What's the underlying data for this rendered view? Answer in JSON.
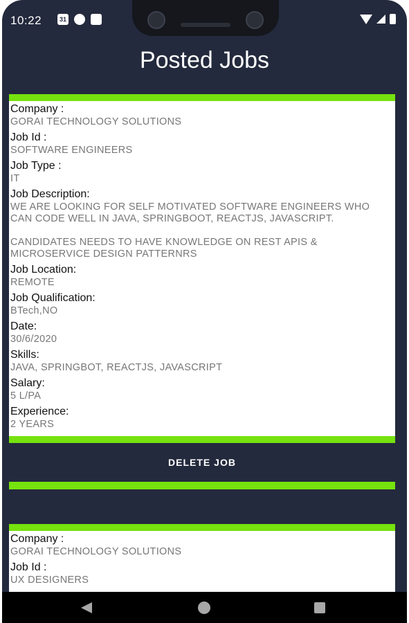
{
  "status_bar": {
    "time": "10:22",
    "left_icons": [
      {
        "icon": "calendar-icon",
        "text": "31"
      },
      {
        "icon": "app-notification-icon",
        "text": ""
      },
      {
        "icon": "sd-card-icon",
        "text": ""
      }
    ],
    "right_icons": [
      "wifi-icon",
      "cell-signal-icon",
      "battery-icon"
    ]
  },
  "header": {
    "title": "Posted Jobs"
  },
  "labels": {
    "company": "Company :",
    "job_id": "Job Id :",
    "job_type": "Job Type :",
    "job_description": "Job Description:",
    "job_location": "Job Location:",
    "job_qualification": "Job Qualification:",
    "date": "Date:",
    "skills": "Skills:",
    "salary": "Salary:",
    "experience": "Experience:"
  },
  "jobs": [
    {
      "company": "GORAI TECHNOLOGY SOLUTIONS",
      "job_id": "SOFTWARE ENGINEERS",
      "job_type": "IT",
      "job_description": "WE ARE LOOKING FOR SELF MOTIVATED SOFTWARE ENGINEERS WHO CAN CODE WELL IN JAVA, SPRINGBOOT, REACTJS, JAVASCRIPT.\n\nCANDIDATES NEEDS TO HAVE KNOWLEDGE ON REST APIS & MICROSERVICE DESIGN PATTERNRS",
      "job_location": "REMOTE",
      "job_qualification": "BTech,NO",
      "date": "30/6/2020",
      "skills": "JAVA, SPRINGBOT, REACTJS, JAVASCRIPT",
      "salary": "5 L/PA",
      "experience": "2 YEARS",
      "delete_label": "DELETE JOB"
    },
    {
      "company": "GORAI TECHNOLOGY SOLUTIONS",
      "job_id": "UX DESIGNERS"
    }
  ],
  "nav_bar": {
    "icons": [
      "back-icon",
      "home-icon",
      "recents-icon"
    ]
  },
  "colors": {
    "background": "#242a3d",
    "accent": "#76e20e",
    "card": "#ffffff"
  }
}
